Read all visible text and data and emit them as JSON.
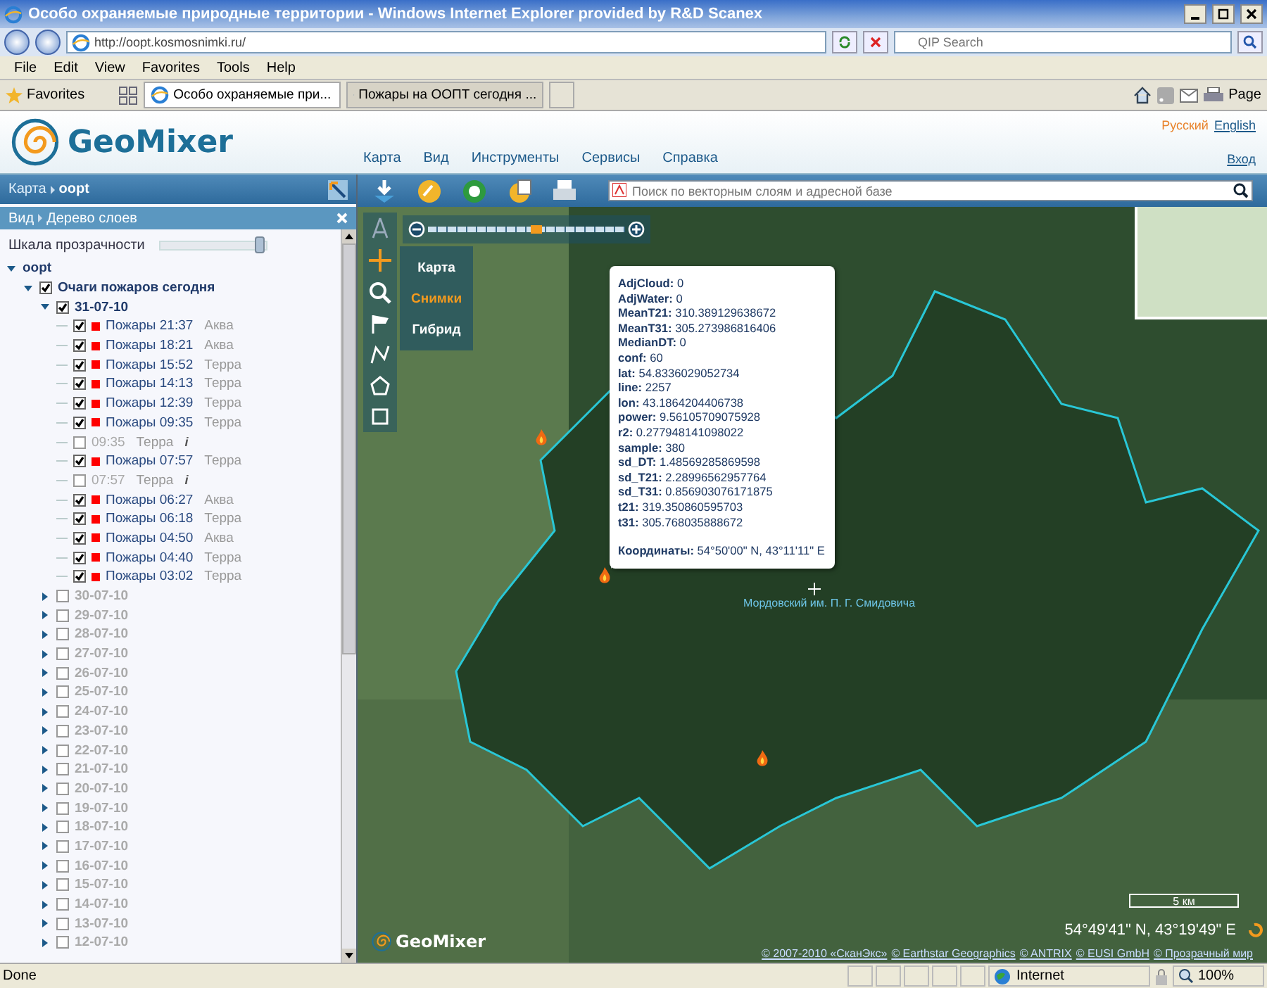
{
  "browser": {
    "title": "Особо охраняемые природные территории - Windows Internet Explorer provided by R&D Scanex",
    "address": "http://oopt.kosmosnimki.ru/",
    "search": {
      "placeholder": "QIP Search"
    },
    "menu": [
      "File",
      "Edit",
      "View",
      "Favorites",
      "Tools",
      "Help"
    ],
    "favorites": "Favorites",
    "tabs": [
      {
        "label": "Особо охраняемые при...",
        "selected": true
      },
      {
        "label": "Пожары на ООПТ сегодня ...",
        "selected": false
      }
    ],
    "page_menu": "Page"
  },
  "app": {
    "logo": "GeoMixer",
    "nav": [
      "Карта",
      "Вид",
      "Инструменты",
      "Сервисы",
      "Справка"
    ],
    "languages": [
      {
        "label": "Русский",
        "selected": true
      },
      {
        "label": "English",
        "selected": false
      }
    ],
    "login": "Вход"
  },
  "breadcrumb": [
    "Карта",
    "oopt"
  ],
  "panel": {
    "breadcrumb": [
      "Вид",
      "Дерево слоев"
    ],
    "opacity_label": "Шкала прозрачности",
    "opacity": {
      "level": 0.95
    }
  },
  "tree": [
    {
      "kind": "root",
      "label": "oopt",
      "expanded": true,
      "children": [
        {
          "kind": "group",
          "label": "Очаги пожаров сегодня",
          "checked": true,
          "expanded": true,
          "children": [
            {
              "kind": "date",
              "label": "31-07-10",
              "checked": true,
              "expanded": true,
              "children": [
                {
                  "kind": "layer",
                  "label": "Пожары 21:37",
                  "satellite": "Аква",
                  "checked": true
                },
                {
                  "kind": "layer",
                  "label": "Пожары 18:21",
                  "satellite": "Аква",
                  "checked": true
                },
                {
                  "kind": "layer",
                  "label": "Пожары 15:52",
                  "satellite": "Терра",
                  "checked": true
                },
                {
                  "kind": "layer",
                  "label": "Пожары 14:13",
                  "satellite": "Терра",
                  "checked": true
                },
                {
                  "kind": "layer",
                  "label": "Пожары 12:39",
                  "satellite": "Терра",
                  "checked": true
                },
                {
                  "kind": "layer",
                  "label": "Пожары 09:35",
                  "satellite": "Терра",
                  "checked": true
                },
                {
                  "kind": "image",
                  "label": "09:35",
                  "satellite": "Терра",
                  "info": "i",
                  "checked": false
                },
                {
                  "kind": "layer",
                  "label": "Пожары 07:57",
                  "satellite": "Терра",
                  "checked": true
                },
                {
                  "kind": "image",
                  "label": "07:57",
                  "satellite": "Терра",
                  "info": "i",
                  "checked": false
                },
                {
                  "kind": "layer",
                  "label": "Пожары 06:27",
                  "satellite": "Аква",
                  "checked": true
                },
                {
                  "kind": "layer",
                  "label": "Пожары 06:18",
                  "satellite": "Терра",
                  "checked": true
                },
                {
                  "kind": "layer",
                  "label": "Пожары 04:50",
                  "satellite": "Аква",
                  "checked": true
                },
                {
                  "kind": "layer",
                  "label": "Пожары 04:40",
                  "satellite": "Терра",
                  "checked": true
                },
                {
                  "kind": "layer",
                  "label": "Пожары 03:02",
                  "satellite": "Терра",
                  "checked": true
                }
              ]
            },
            {
              "kind": "date",
              "label": "30-07-10",
              "checked": false,
              "expanded": false
            },
            {
              "kind": "date",
              "label": "29-07-10",
              "checked": false,
              "expanded": false
            },
            {
              "kind": "date",
              "label": "28-07-10",
              "checked": false,
              "expanded": false
            },
            {
              "kind": "date",
              "label": "27-07-10",
              "checked": false,
              "expanded": false
            },
            {
              "kind": "date",
              "label": "26-07-10",
              "checked": false,
              "expanded": false
            },
            {
              "kind": "date",
              "label": "25-07-10",
              "checked": false,
              "expanded": false
            },
            {
              "kind": "date",
              "label": "24-07-10",
              "checked": false,
              "expanded": false
            },
            {
              "kind": "date",
              "label": "23-07-10",
              "checked": false,
              "expanded": false
            },
            {
              "kind": "date",
              "label": "22-07-10",
              "checked": false,
              "expanded": false
            },
            {
              "kind": "date",
              "label": "21-07-10",
              "checked": false,
              "expanded": false
            },
            {
              "kind": "date",
              "label": "20-07-10",
              "checked": false,
              "expanded": false
            },
            {
              "kind": "date",
              "label": "19-07-10",
              "checked": false,
              "expanded": false
            },
            {
              "kind": "date",
              "label": "18-07-10",
              "checked": false,
              "expanded": false
            },
            {
              "kind": "date",
              "label": "17-07-10",
              "checked": false,
              "expanded": false
            },
            {
              "kind": "date",
              "label": "16-07-10",
              "checked": false,
              "expanded": false
            },
            {
              "kind": "date",
              "label": "15-07-10",
              "checked": false,
              "expanded": false
            },
            {
              "kind": "date",
              "label": "14-07-10",
              "checked": false,
              "expanded": false
            },
            {
              "kind": "date",
              "label": "13-07-10",
              "checked": false,
              "expanded": false
            },
            {
              "kind": "date",
              "label": "12-07-10",
              "checked": false,
              "expanded": false
            }
          ]
        }
      ]
    }
  ],
  "map": {
    "search": {
      "placeholder": "Поиск по векторным слоям и адресной базе"
    },
    "zoom": {
      "level": 0.55
    },
    "base_layers": [
      {
        "label": "Карта",
        "selected": false
      },
      {
        "label": "Снимки",
        "selected": true
      },
      {
        "label": "Гибрид",
        "selected": false
      }
    ],
    "popup": {
      "fields": [
        {
          "key": "AdjCloud:",
          "value": "0"
        },
        {
          "key": "AdjWater:",
          "value": "0"
        },
        {
          "key": "MeanT21:",
          "value": "310.389129638672"
        },
        {
          "key": "MeanT31:",
          "value": "305.273986816406"
        },
        {
          "key": "MedianDT:",
          "value": "0"
        },
        {
          "key": "conf:",
          "value": "60"
        },
        {
          "key": "lat:",
          "value": "54.8336029052734"
        },
        {
          "key": "line:",
          "value": "2257"
        },
        {
          "key": "lon:",
          "value": "43.1864204406738"
        },
        {
          "key": "power:",
          "value": "9.56105709075928"
        },
        {
          "key": "r2:",
          "value": "0.277948141098022"
        },
        {
          "key": "sample:",
          "value": "380"
        },
        {
          "key": "sd_DT:",
          "value": "1.48569285869598"
        },
        {
          "key": "sd_T21:",
          "value": "2.28996562957764"
        },
        {
          "key": "sd_T31:",
          "value": "0.856903076171875"
        },
        {
          "key": "t21:",
          "value": "319.350860595703"
        },
        {
          "key": "t31:",
          "value": "305.768035888672"
        }
      ],
      "coordinates_label": "Координаты:",
      "coordinates": "54°50'00\" N, 43°11'11\" E"
    },
    "label": "Мордовский им. П. Г. Смидовича",
    "scale": "5 км",
    "coordinates": "54°49'41\" N, 43°19'49\" E",
    "logo": "GeoMixer",
    "attribution": [
      "© 2007-2010 «СканЭкс»",
      "© Earthstar Geographics",
      "© ANTRIX",
      "© EUSI GmbH",
      "© Прозрачный мир"
    ]
  },
  "status": {
    "text": "Done",
    "zone": "Internet",
    "zoom": "100%"
  }
}
